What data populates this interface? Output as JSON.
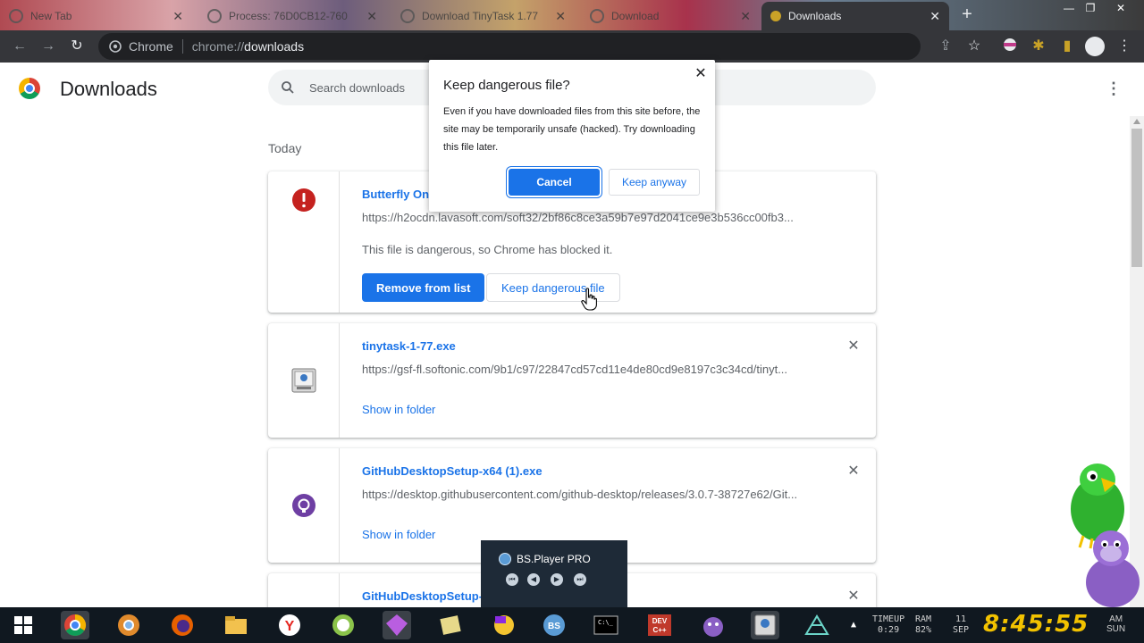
{
  "browser": {
    "tabs": [
      {
        "label": "New Tab"
      },
      {
        "label": "Process: 76D0CB12-760"
      },
      {
        "label": "Download TinyTask 1.77"
      },
      {
        "label": "Download"
      },
      {
        "label": "Downloads"
      }
    ],
    "omnibox": {
      "chip": "Chrome",
      "scheme": "chrome://",
      "host": "downloads"
    }
  },
  "page": {
    "title": "Downloads",
    "search_placeholder": "Search downloads",
    "section_label": "Today"
  },
  "downloads": [
    {
      "name": "Butterfly On D",
      "url": "https://h2ocdn.lavasoft.com/soft32/2bf86c8ce3a59b7e97d2041ce9e3b536cc00fb3...",
      "warning": "This file is dangerous, so Chrome has blocked it.",
      "primary_action": "Remove from list",
      "secondary_action": "Keep dangerous file",
      "icon": "danger-icon"
    },
    {
      "name": "tinytask-1-77.exe",
      "url": "https://gsf-fl.softonic.com/9b1/c97/22847cd57cd11e4de80cd9e8197c3c34cd/tinyt...",
      "action": "Show in folder",
      "icon": "exe-icon"
    },
    {
      "name": "GitHubDesktopSetup-x64 (1).exe",
      "url": "https://desktop.githubusercontent.com/github-desktop/releases/3.0.7-38727e62/Git...",
      "action": "Show in folder",
      "icon": "github-icon"
    },
    {
      "name": "GitHubDesktopSetup-x",
      "icon": "github-icon"
    }
  ],
  "dialog": {
    "title": "Keep dangerous file?",
    "body": "Even if you have downloaded files from this site before, the site may be temporarily unsafe (hacked). Try downloading this file later.",
    "cancel_label": "Cancel",
    "keep_label": "Keep anyway"
  },
  "overlay": {
    "title": "BS.Player PRO"
  },
  "taskbar": {
    "timeup_label": "TIMEUP",
    "timeup_value": "0:29",
    "ram_label": "RAM",
    "ram_value": "82%",
    "date_day": "11",
    "date_month": "SEP",
    "clock": "8:45:55",
    "ampm": "AM",
    "weekday": "SUN"
  },
  "colors": {
    "accent": "#1a73e8",
    "danger": "#c5221f",
    "clock": "#f2c200"
  }
}
